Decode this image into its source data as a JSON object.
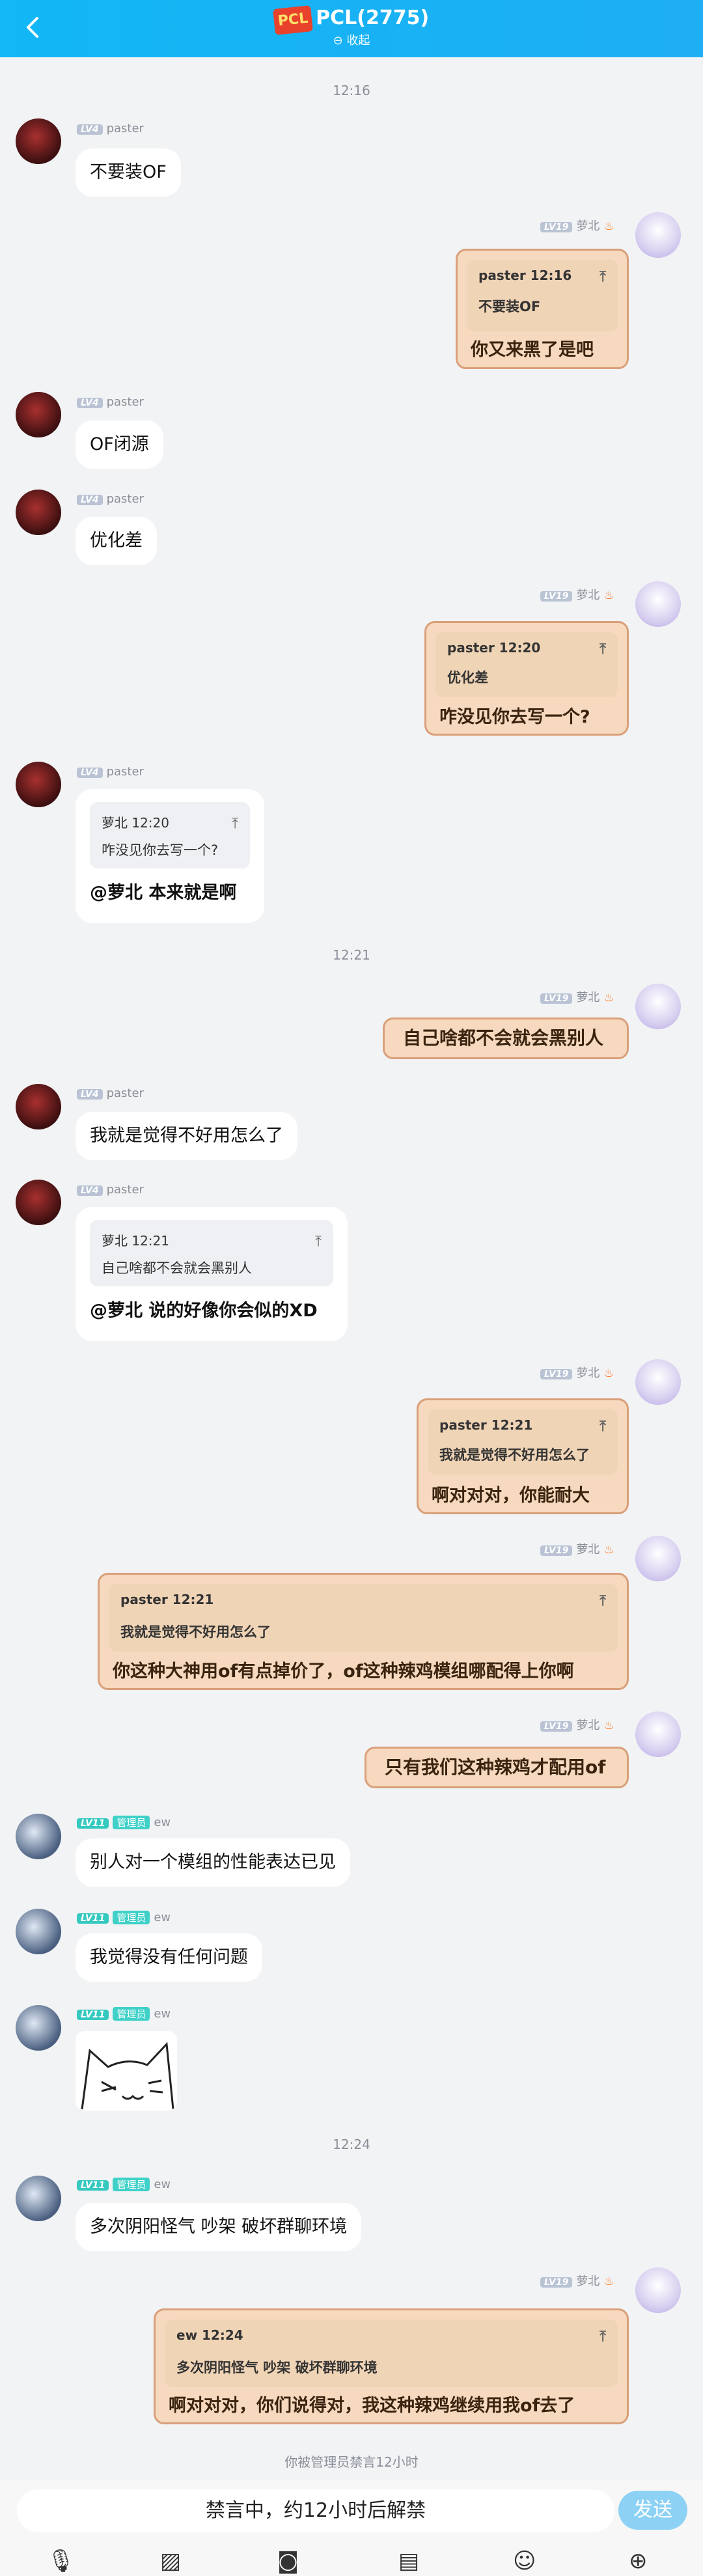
{
  "header": {
    "title": "PCL(2775)",
    "logo_text": "PCL",
    "collapse_label": "⊖ 收起"
  },
  "times": [
    "12:16",
    "12:21",
    "12:24"
  ],
  "users": {
    "paster": {
      "level": "LV4",
      "name": "paster"
    },
    "me": {
      "level": "LV19",
      "name": "萝北"
    },
    "ew": {
      "level": "LV11",
      "role": "管理员",
      "name": "ew"
    }
  },
  "messages": {
    "m1": {
      "text": "不要装OF"
    },
    "m2": {
      "quote_header": "paster  12:16",
      "quote_text": "不要装OF",
      "reply": "你又来黑了是吧"
    },
    "m3": {
      "text": "OF闭源"
    },
    "m4": {
      "text": "优化差"
    },
    "m5": {
      "quote_header": "paster  12:20",
      "quote_text": "优化差",
      "reply": "咋没见你去写一个?"
    },
    "m6": {
      "quote_header": "萝北  12:20",
      "quote_text": "咋没见你去写一个?",
      "reply": "@萝北  本来就是啊"
    },
    "m7": {
      "text": "自己啥都不会就会黑别人"
    },
    "m8": {
      "text": "我就是觉得不好用怎么了"
    },
    "m9": {
      "quote_header": "萝北  12:21",
      "quote_text": "自己啥都不会就会黑别人",
      "reply": "@萝北  说的好像你会似的XD"
    },
    "m10": {
      "quote_header": "paster  12:21",
      "quote_text": "我就是觉得不好用怎么了",
      "reply": "啊对对对，你能耐大"
    },
    "m11": {
      "quote_header": "paster  12:21",
      "quote_text": "我就是觉得不好用怎么了",
      "reply": "你这种大神用of有点掉价了，of这种辣鸡模组哪配得上你啊"
    },
    "m12": {
      "text": "只有我们这种辣鸡才配用of"
    },
    "m13": {
      "text": "别人对一个模组的性能表达已见"
    },
    "m14": {
      "text": "我觉得没有任何问题"
    },
    "m15": {
      "text": "多次阴阳怪气  吵架  破坏群聊环境"
    },
    "m16": {
      "quote_header": "ew  12:24",
      "quote_text": "多次阴阳怪气  吵架  破坏群聊环境",
      "reply": "啊对对对，你们说得对，我这种辣鸡继续用我of去了"
    }
  },
  "notice": "你被管理员禁言12小时",
  "input": {
    "mute_text": "禁言中，约12小时后解禁",
    "send_label": "发送"
  },
  "toolbar": {
    "icons": [
      "microphone-icon",
      "image-icon",
      "camera-icon",
      "folder-icon",
      "emoji-icon",
      "plus-icon"
    ]
  }
}
